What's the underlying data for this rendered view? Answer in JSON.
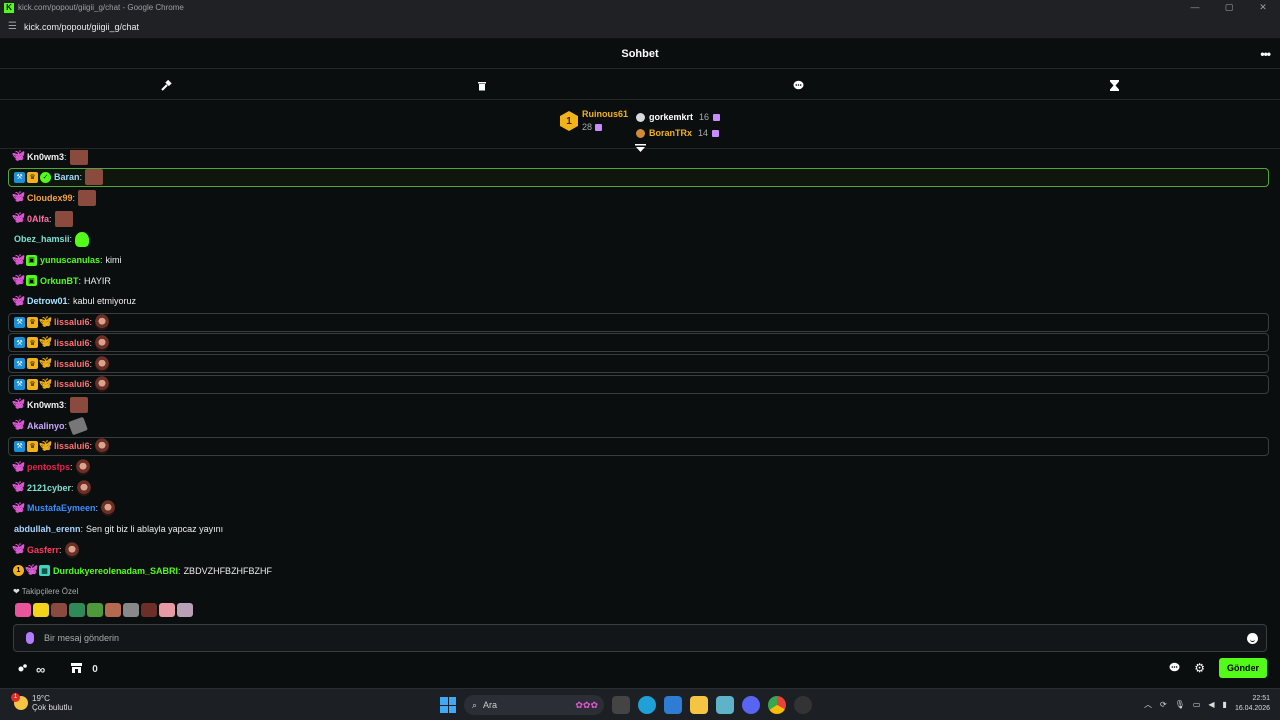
{
  "browser": {
    "title": "kick.com/popout/giigii_g/chat - Google Chrome",
    "url": "kick.com/popout/giigii_g/chat"
  },
  "chat": {
    "title": "Sohbet"
  },
  "leaderboard": {
    "first": {
      "rank": "1",
      "name": "Ruinous61",
      "count": "28"
    },
    "others": [
      {
        "name": "gorkemkrt",
        "count": "16",
        "color": "#ffffff",
        "medal": "#d9d9d9"
      },
      {
        "name": "BoranTRx",
        "count": "14",
        "color": "#f2b21a",
        "medal": "#d08a3a"
      }
    ]
  },
  "messages": [
    {
      "user": "Kn0wm3",
      "color": "#f0f0f0",
      "badges": [
        "fly"
      ],
      "text": "",
      "emote": "meme",
      "highlight": "none"
    },
    {
      "user": "Baran",
      "color": "#9ad7ff",
      "badges": [
        "mod",
        "vip",
        "verified"
      ],
      "text": "",
      "emote": "meme",
      "highlight": "green"
    },
    {
      "user": "Cloudex99",
      "color": "#f2a341",
      "badges": [
        "fly"
      ],
      "text": "",
      "emote": "meme",
      "highlight": "none"
    },
    {
      "user": "0Alfa",
      "color": "#ff6fa7",
      "badges": [
        "fly"
      ],
      "text": "",
      "emote": "meme",
      "highlight": "none"
    },
    {
      "user": "Obez_hamsii",
      "color": "#7ee0d0",
      "badges": [],
      "text": "",
      "emote": "ghost",
      "highlight": "none"
    },
    {
      "user": "yunuscanulas",
      "color": "#53fc18",
      "badges": [
        "fly",
        "sub"
      ],
      "text": "kimi",
      "emote": "",
      "highlight": "none"
    },
    {
      "user": "OrkunBT",
      "color": "#53fc18",
      "badges": [
        "fly",
        "sub"
      ],
      "text": "HAYIR",
      "emote": "",
      "highlight": "none"
    },
    {
      "user": "Detrow01",
      "color": "#a7e3ff",
      "badges": [
        "fly"
      ],
      "text": "kabul etmiyoruz",
      "emote": "",
      "highlight": "none"
    },
    {
      "user": "lissalui6",
      "color": "#ff6f6f",
      "badges": [
        "mod",
        "vip",
        "flyo"
      ],
      "text": "",
      "emote": "face",
      "highlight": "gray"
    },
    {
      "user": "lissalui6",
      "color": "#ff6f6f",
      "badges": [
        "mod",
        "vip",
        "flyo"
      ],
      "text": "",
      "emote": "face",
      "highlight": "gray"
    },
    {
      "user": "lissalui6",
      "color": "#ff6f6f",
      "badges": [
        "mod",
        "vip",
        "flyo"
      ],
      "text": "",
      "emote": "face",
      "highlight": "gray"
    },
    {
      "user": "lissalui6",
      "color": "#ff6f6f",
      "badges": [
        "mod",
        "vip",
        "flyo"
      ],
      "text": "",
      "emote": "face",
      "highlight": "gray"
    },
    {
      "user": "Kn0wm3",
      "color": "#f0f0f0",
      "badges": [
        "fly"
      ],
      "text": "",
      "emote": "meme",
      "highlight": "none"
    },
    {
      "user": "Akalinyo",
      "color": "#c9a7ff",
      "badges": [
        "fly"
      ],
      "text": "",
      "emote": "gray",
      "highlight": "none"
    },
    {
      "user": "lissalui6",
      "color": "#ff6f6f",
      "badges": [
        "mod",
        "vip",
        "flyo"
      ],
      "text": "",
      "emote": "face",
      "highlight": "gray"
    },
    {
      "user": "pentosfps",
      "color": "#e0244c",
      "badges": [
        "fly"
      ],
      "text": "",
      "emote": "face",
      "highlight": "none"
    },
    {
      "user": "2121cyber",
      "color": "#7ee0d0",
      "badges": [
        "fly"
      ],
      "text": "",
      "emote": "face",
      "highlight": "none"
    },
    {
      "user": "MustafaEymeen",
      "color": "#3a8cff",
      "badges": [
        "fly"
      ],
      "text": "",
      "emote": "face",
      "highlight": "none"
    },
    {
      "user": "abdullah_erenn",
      "color": "#a7d4ff",
      "badges": [],
      "text": "Sen git biz li ablayla yapcaz yayını",
      "emote": "",
      "highlight": "none"
    },
    {
      "user": "Gasferr",
      "color": "#ff3a5a",
      "badges": [
        "fly"
      ],
      "text": "",
      "emote": "face",
      "highlight": "none"
    },
    {
      "user": "Durdukyereolenadam_SABRI",
      "color": "#53fc18",
      "badges": [
        "og",
        "fly",
        "gift"
      ],
      "text": "ZBDVZHFBZHFBZHF",
      "emote": "",
      "highlight": "none"
    }
  ],
  "followers_only": {
    "label": "Takipçilere Özel",
    "emote_colors": [
      "#e8559c",
      "#f2d21a",
      "#8a4a3e",
      "#2e8b57",
      "#4e9a3a",
      "#b46a4e",
      "#888888",
      "#6b2f28",
      "#e89aa4",
      "#b9a0b8"
    ]
  },
  "input": {
    "placeholder": "Bir mesaj gönderin"
  },
  "bottom": {
    "points": "0",
    "send_label": "Gönder"
  },
  "taskbar": {
    "temp": "19°C",
    "weather": "Çok bulutlu",
    "search": "Ara",
    "time": "22:51",
    "date": "16.04.2026",
    "weather_badge": "1"
  }
}
